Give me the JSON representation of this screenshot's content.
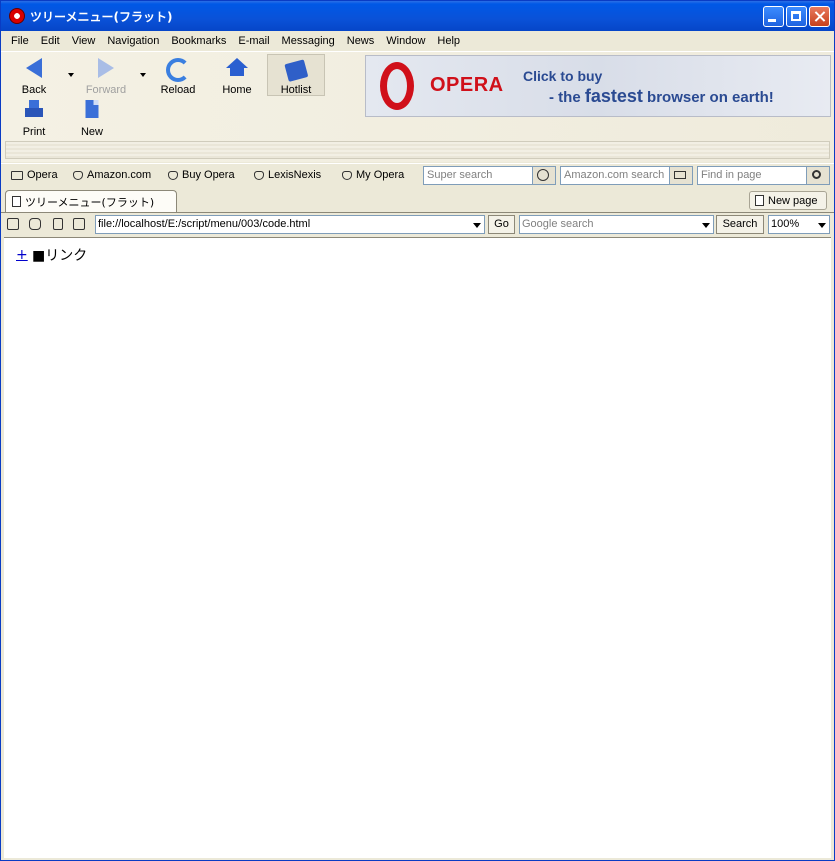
{
  "window": {
    "title": "ツリーメニュー(フラット)"
  },
  "menu": [
    "File",
    "Edit",
    "View",
    "Navigation",
    "Bookmarks",
    "E-mail",
    "Messaging",
    "News",
    "Window",
    "Help"
  ],
  "toolbar": {
    "back": "Back",
    "forward": "Forward",
    "reload": "Reload",
    "home": "Home",
    "hotlist": "Hotlist",
    "print": "Print",
    "new": "New"
  },
  "banner": {
    "brand": "OPERA",
    "line1": "Click to buy",
    "line2_pre": "- the ",
    "line2_bold": "fastest",
    "line2_post": " browser on earth!"
  },
  "personal_bar": {
    "items": [
      "Opera",
      "Amazon.com",
      "Buy Opera",
      "LexisNexis",
      "My Opera"
    ],
    "super_search": "Super search",
    "amazon_search": "Amazon.com search",
    "find_in_page": "Find in page"
  },
  "tabs": {
    "active": "ツリーメニュー(フラット)",
    "new_page": "New page"
  },
  "address": {
    "url": "file://localhost/E:/script/menu/003/code.html",
    "go": "Go",
    "google_placeholder": "Google search",
    "search": "Search",
    "zoom": "100%"
  },
  "content": {
    "toggle": "+",
    "label": "■リンク"
  }
}
